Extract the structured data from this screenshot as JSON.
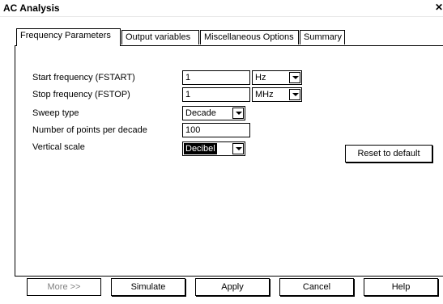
{
  "window": {
    "title": "AC Analysis",
    "close_glyph": "✕"
  },
  "tabs": [
    {
      "label": "Frequency Parameters",
      "active": true
    },
    {
      "label": "Output variables",
      "active": false
    },
    {
      "label": "Miscellaneous Options",
      "active": false
    },
    {
      "label": "Summary",
      "active": false
    }
  ],
  "form": {
    "start_label": "Start frequency (FSTART)",
    "start_value": "1",
    "start_unit": "Hz",
    "stop_label": "Stop frequency (FSTOP)",
    "stop_value": "1",
    "stop_unit": "MHz",
    "sweep_label": "Sweep type",
    "sweep_value": "Decade",
    "points_label": "Number of points per decade",
    "points_value": "100",
    "scale_label": "Vertical scale",
    "scale_value": "Decibel"
  },
  "reset_label": "Reset to default",
  "buttons": {
    "more": "More >>",
    "simulate": "Simulate",
    "apply": "Apply",
    "cancel": "Cancel",
    "help": "Help"
  },
  "icons": {
    "dropdown": "chevron-down-icon",
    "close": "close-icon"
  }
}
